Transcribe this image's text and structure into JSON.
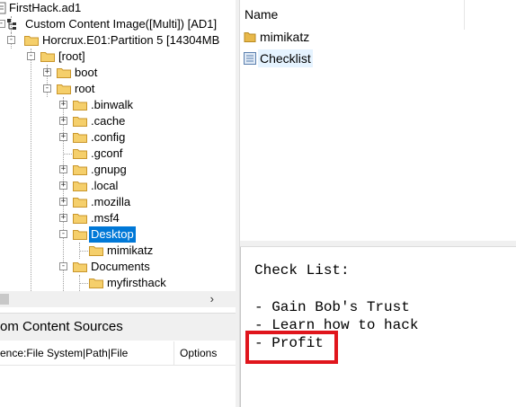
{
  "tree": {
    "nodes": [
      {
        "id": "n0",
        "label": "FirstHack.ad1",
        "icon": "document-icon",
        "expander": "",
        "selected": false
      },
      {
        "id": "n1",
        "label": "Custom Content Image([Multi]) [AD1]",
        "icon": "tree-structure-icon",
        "expander": "-",
        "selected": false
      },
      {
        "id": "n2",
        "label": "Horcrux.E01:Partition 5 [14304MB",
        "icon": "folder-icon",
        "expander": "-",
        "selected": false
      },
      {
        "id": "n3",
        "label": "[root]",
        "icon": "folder-icon",
        "expander": "-",
        "selected": false
      },
      {
        "id": "n4",
        "label": "boot",
        "icon": "folder-icon",
        "expander": "+",
        "selected": false
      },
      {
        "id": "n5",
        "label": "root",
        "icon": "folder-icon",
        "expander": "-",
        "selected": false
      },
      {
        "id": "n6",
        "label": ".binwalk",
        "icon": "folder-icon",
        "expander": "+",
        "selected": false
      },
      {
        "id": "n7",
        "label": ".cache",
        "icon": "folder-icon",
        "expander": "+",
        "selected": false
      },
      {
        "id": "n8",
        "label": ".config",
        "icon": "folder-icon",
        "expander": "+",
        "selected": false
      },
      {
        "id": "n9",
        "label": ".gconf",
        "icon": "folder-icon",
        "expander": "",
        "selected": false
      },
      {
        "id": "n10",
        "label": ".gnupg",
        "icon": "folder-icon",
        "expander": "+",
        "selected": false
      },
      {
        "id": "n11",
        "label": ".local",
        "icon": "folder-icon",
        "expander": "+",
        "selected": false
      },
      {
        "id": "n12",
        "label": ".mozilla",
        "icon": "folder-icon",
        "expander": "+",
        "selected": false
      },
      {
        "id": "n13",
        "label": ".msf4",
        "icon": "folder-icon",
        "expander": "+",
        "selected": false
      },
      {
        "id": "n14",
        "label": "Desktop",
        "icon": "folder-icon",
        "expander": "-",
        "selected": true
      },
      {
        "id": "n15",
        "label": "mimikatz",
        "icon": "folder-icon",
        "expander": "",
        "selected": false
      },
      {
        "id": "n16",
        "label": "Documents",
        "icon": "folder-icon",
        "expander": "-",
        "selected": false
      },
      {
        "id": "n17",
        "label": "myfirsthack",
        "icon": "folder-icon",
        "expander": "",
        "selected": false
      }
    ],
    "scroll_arrow": "›"
  },
  "content_sources": {
    "header": "om Content Sources",
    "columns_left": "ence:File System|Path|File",
    "columns_options": "Options"
  },
  "file_list": {
    "header_name": "Name",
    "rows": [
      {
        "name": "mimikatz",
        "icon": "folder-icon",
        "selected": false
      },
      {
        "name": "Checklist",
        "icon": "text-file-icon",
        "selected": true
      }
    ]
  },
  "viewer": {
    "lines": [
      "Check List:",
      "",
      "- Gain Bob's Trust",
      "- Learn how to hack",
      "- Profit"
    ],
    "highlight_color": "#e0151c"
  },
  "colors": {
    "selection": "#0078d7",
    "folder": "#e8b84a",
    "panel_bg": "#f0f0f0"
  }
}
